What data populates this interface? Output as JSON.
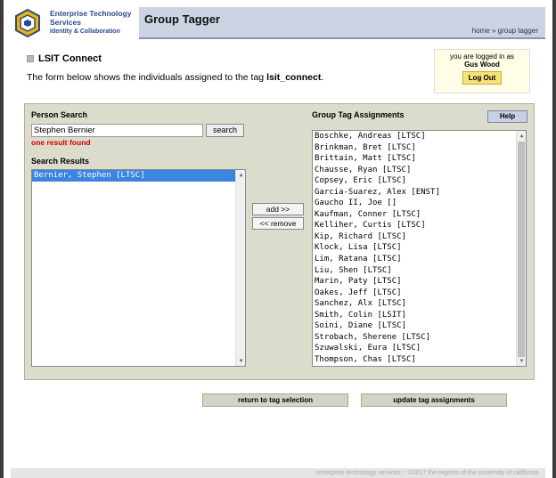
{
  "logo": {
    "line1": "Enterprise Technology",
    "line2": "Services",
    "line3": "Identity & Collaboration"
  },
  "header": {
    "title": "Group Tagger",
    "breadcrumb": "home » group tagger"
  },
  "page": {
    "section_title": "LSIT Connect",
    "description_prefix": "The form below shows the individuals assigned to the tag ",
    "tag_name": "lsit_connect",
    "description_suffix": "."
  },
  "login": {
    "line1": "you are logged in as",
    "user": "Gus Wood",
    "logout_label": "Log Out"
  },
  "person_search": {
    "label": "Person Search",
    "value": "Stephen Bernier",
    "search_label": "search",
    "status": "one result found"
  },
  "search_results": {
    "label": "Search Results",
    "items": [
      "Bernier, Stephen [LTSC]"
    ]
  },
  "actions": {
    "add_label": "add >>",
    "remove_label": "<< remove"
  },
  "assignments": {
    "label": "Group Tag Assignments",
    "help_label": "Help",
    "items": [
      "Boschke, Andreas [LTSC]",
      "Brinkman, Bret [LTSC]",
      "Brittain, Matt [LTSC]",
      "Chausse, Ryan [LTSC]",
      "Copsey, Eric [LTSC]",
      "Garcia-Suarez, Alex [ENST]",
      "Gaucho II, Joe []",
      "Kaufman, Conner [LTSC]",
      "Kelliher, Curtis [LTSC]",
      "Kip, Richard [LTSC]",
      "Klock, Lisa [LTSC]",
      "Lim, Ratana [LTSC]",
      "Liu, Shen [LTSC]",
      "Marin, Paty [LTSC]",
      "Oakes, Jeff [LTSC]",
      "Sanchez, Alx [LTSC]",
      "Smith, Colin [LSIT]",
      "Soini, Diane [LTSC]",
      "Strobach, Sherene [LTSC]",
      "Szuwalski, Eura [LTSC]",
      "Thompson, Chas [LTSC]"
    ]
  },
  "bottom": {
    "return_label": "return to tag selection",
    "update_label": "update tag assignments"
  },
  "footer": {
    "text": "enterprise technology services :: ©2017 the regents of the university of california"
  }
}
